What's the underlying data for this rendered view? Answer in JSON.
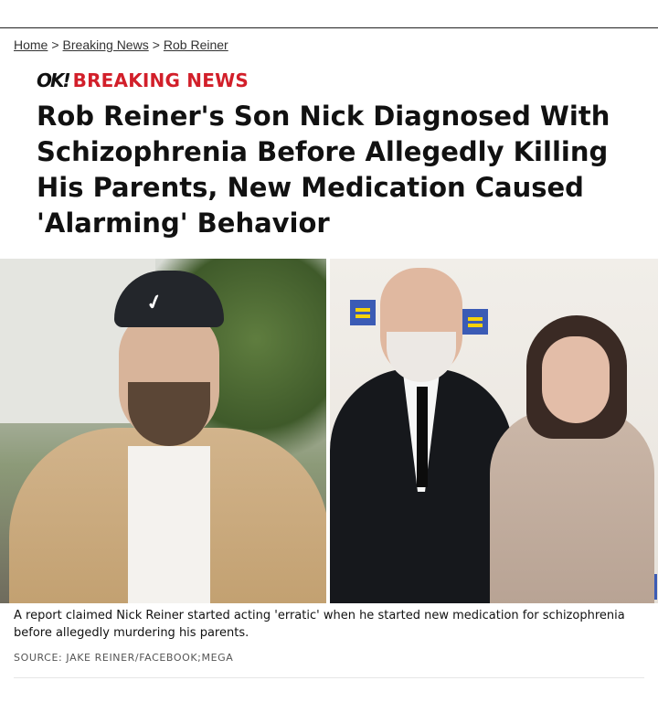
{
  "breadcrumb": {
    "items": [
      "Home",
      "Breaking News",
      "Rob Reiner"
    ],
    "separator": ">"
  },
  "kicker": {
    "logo": "OK!",
    "label": "BREAKING NEWS",
    "color": "#d21f2a"
  },
  "article": {
    "headline": "Rob Reiner's Son Nick Diagnosed With Schizophrenia Before Allegedly Killing His Parents, New Medication Caused 'Alarming' Behavior"
  },
  "image": {
    "caption": "A report claimed Nick Reiner started acting 'erratic' when he started new medication for schizophrenia before allegedly murdering his parents.",
    "source": "SOURCE: JAKE REINER/FACEBOOK;MEGA"
  },
  "icons": {
    "brand_mark": "hrc-equality-logo"
  }
}
